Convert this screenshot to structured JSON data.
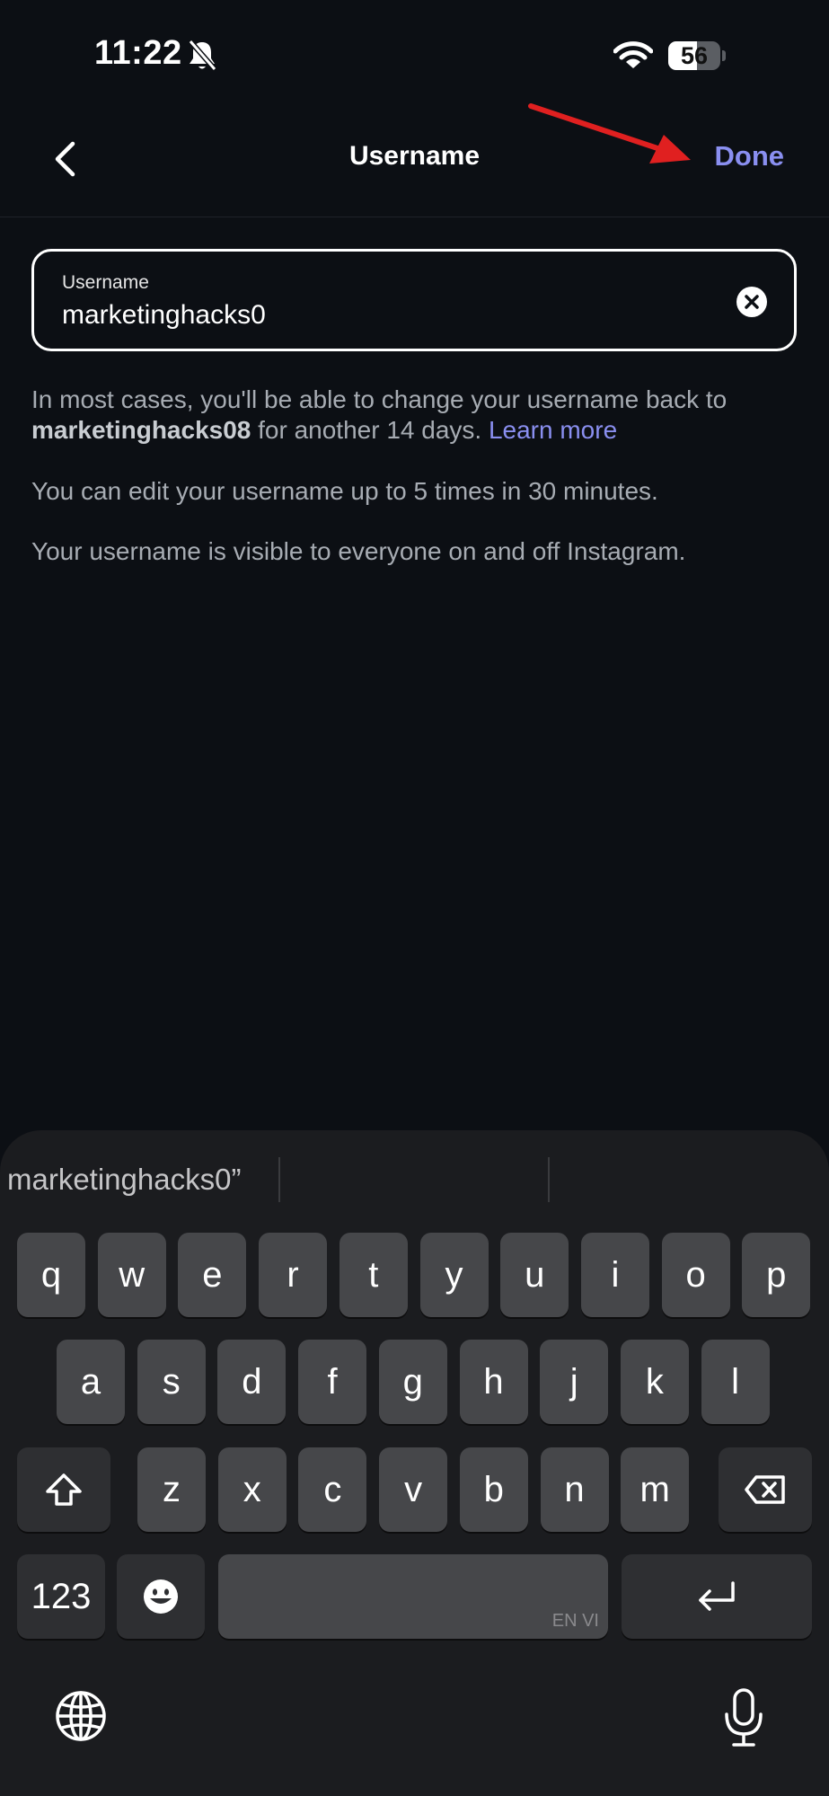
{
  "status_bar": {
    "time": "11:22",
    "battery_level": "56",
    "battery_fraction": 0.56
  },
  "nav": {
    "title": "Username",
    "done_label": "Done",
    "accent_color": "#8a8ff0"
  },
  "input": {
    "label": "Username",
    "value": "marketinghacks0"
  },
  "help": {
    "p1_prefix": "In most cases, you'll be able to change your username back to ",
    "p1_username": "marketinghacks08",
    "p1_suffix": " for another 14 days. ",
    "p1_link": "Learn more",
    "p2": "You can edit your username up to 5 times in 30 minutes.",
    "p3": "Your username is visible to everyone on and off Instagram."
  },
  "keyboard": {
    "suggestion": "marketinghacks0”",
    "row1": [
      "q",
      "w",
      "e",
      "r",
      "t",
      "y",
      "u",
      "i",
      "o",
      "p"
    ],
    "row2": [
      "a",
      "s",
      "d",
      "f",
      "g",
      "h",
      "j",
      "k",
      "l"
    ],
    "row3": [
      "z",
      "x",
      "c",
      "v",
      "b",
      "n",
      "m"
    ],
    "numbers_label": "123",
    "space_lang": "EN VI"
  }
}
